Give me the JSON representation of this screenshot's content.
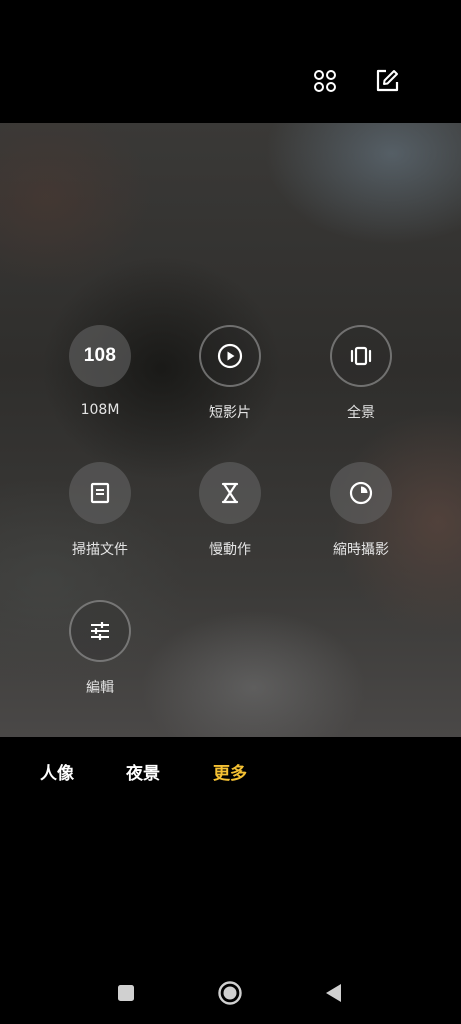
{
  "top_bar": {
    "icons": [
      "grid-icon",
      "edit-icon"
    ]
  },
  "modes": [
    {
      "label": "108M",
      "icon": "108-badge",
      "circle_text": "108"
    },
    {
      "label": "短影片",
      "icon": "play-circle-icon"
    },
    {
      "label": "全景",
      "icon": "panorama-icon"
    },
    {
      "label": "掃描文件",
      "icon": "document-icon"
    },
    {
      "label": "慢動作",
      "icon": "hourglass-icon"
    },
    {
      "label": "縮時攝影",
      "icon": "timer-icon"
    },
    {
      "label": "編輯",
      "icon": "sliders-icon"
    }
  ],
  "bottom_tabs": [
    {
      "label": "人像",
      "active": false
    },
    {
      "label": "夜景",
      "active": false
    },
    {
      "label": "更多",
      "active": true
    }
  ],
  "colors": {
    "active_tab": "#f5c133",
    "background": "#000000"
  },
  "nav_bar": {
    "icons": [
      "recents-icon",
      "home-icon",
      "back-icon"
    ]
  }
}
